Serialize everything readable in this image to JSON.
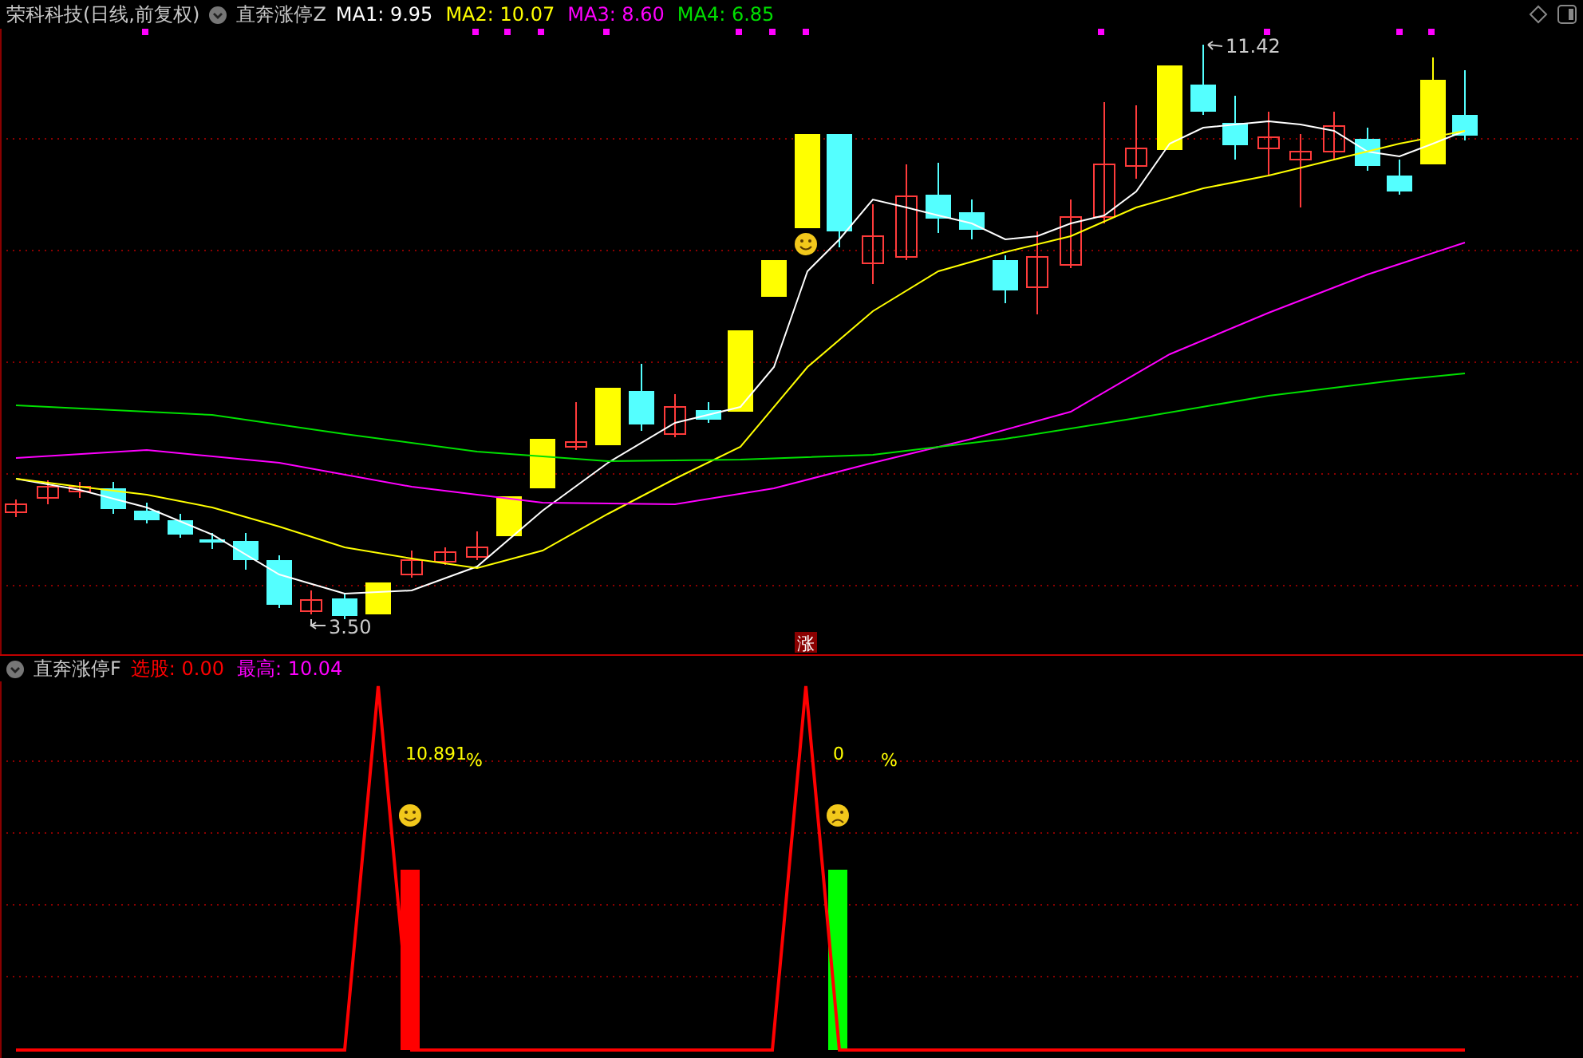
{
  "main_panel": {
    "stock_name": "荣科科技(日线,前复权)",
    "indicator": "直奔涨停Z",
    "ma_lines": [
      {
        "text": "MA1: 9.95",
        "color": "#ffffff"
      },
      {
        "text": "MA2: 10.07",
        "color": "#ffff00"
      },
      {
        "text": "MA3: 8.60",
        "color": "#ff00ff"
      },
      {
        "text": "MA4: 6.85",
        "color": "#00e000"
      }
    ],
    "high_marker": "11.42",
    "low_marker": "3.50",
    "limit_up_mark": "涨"
  },
  "sub_panel": {
    "indicator": "直奔涨停F",
    "readings": [
      {
        "text": "选股: 0.00",
        "color": "#ff0000"
      },
      {
        "text": "最高: 10.04",
        "color": "#ff00ff"
      }
    ],
    "signals": [
      {
        "value": "10.891",
        "unit": "%",
        "kind": "happy",
        "color": "#ff0000"
      },
      {
        "value": "0",
        "unit": "%",
        "kind": "sad",
        "color": "#00ff00"
      }
    ]
  }
}
